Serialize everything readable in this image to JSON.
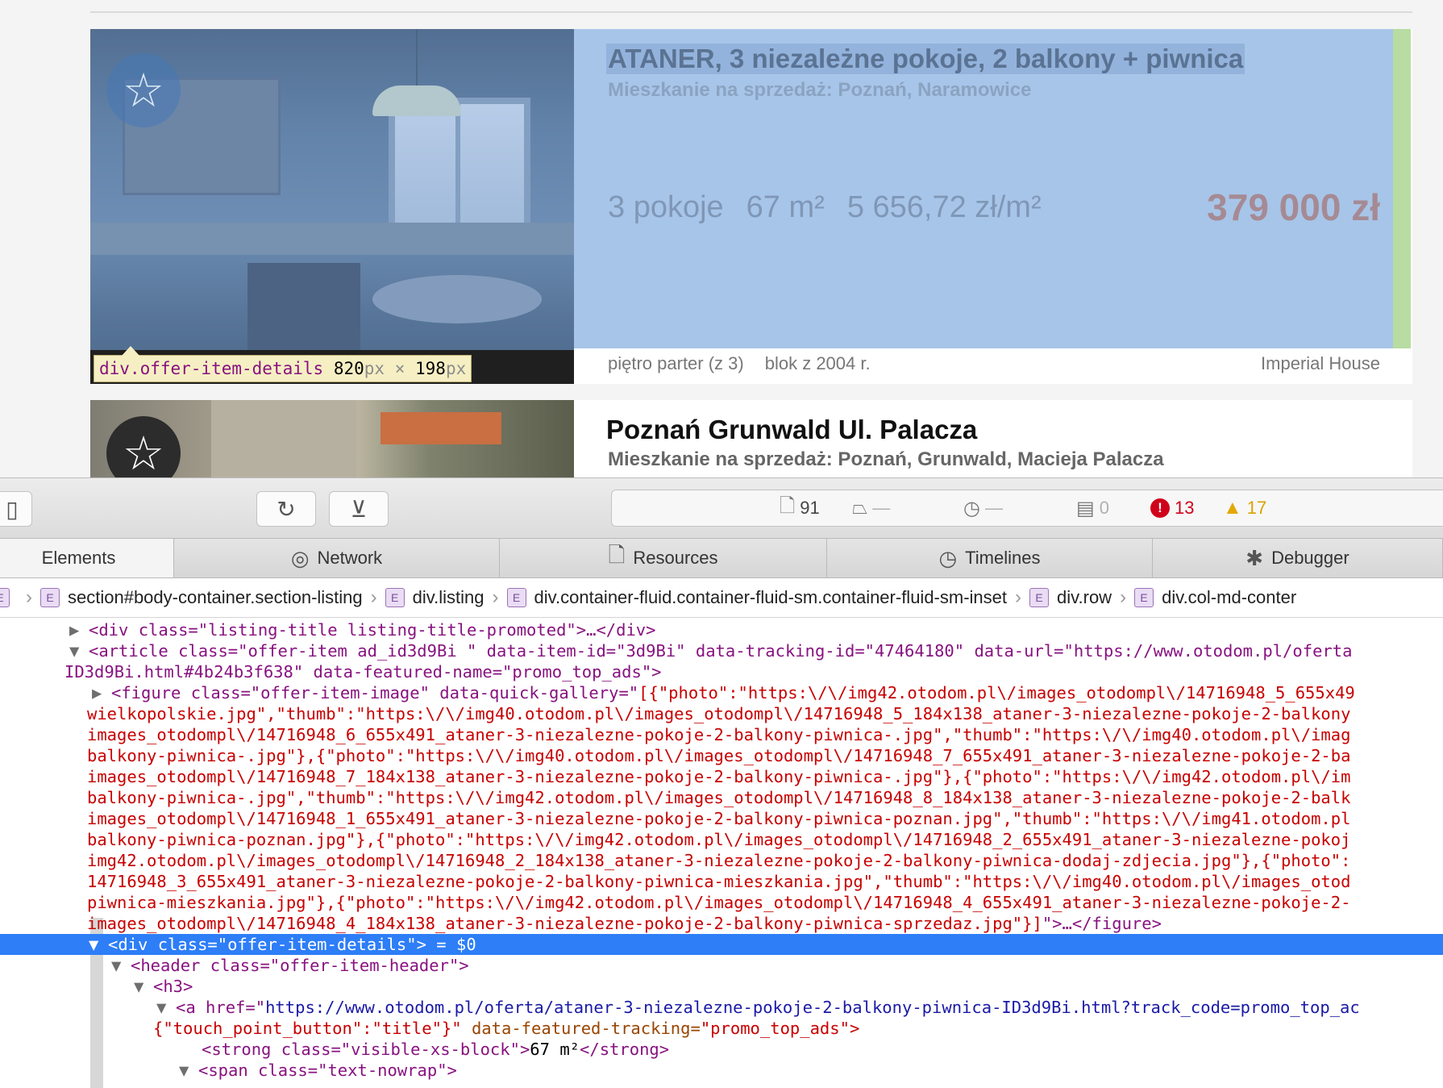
{
  "listing": {
    "offer1": {
      "title": "ATANER, 3 niezależne pokoje, 2 balkony + piwnica",
      "subtitle": "Mieszkanie na sprzedaż: Poznań, Naramowice",
      "rooms": "3 pokoje",
      "area": "67 m²",
      "price_per_m2": "5 656,72 zł/m²",
      "price": "379 000 zł",
      "floor": "piętro parter (z 3)",
      "building": "blok z 2004 r.",
      "agency": "Imperial House",
      "tooltip_selector": "div.offer-item-details",
      "tooltip_w": "820",
      "tooltip_h": "198",
      "tooltip_unit": "px",
      "tooltip_x": "×"
    },
    "offer2": {
      "title": "Poznań Grunwald Ul. Palacza",
      "subtitle": "Mieszkanie na sprzedaż: Poznań, Grunwald, Macieja Palacza"
    },
    "favorite_icon": "star-icon"
  },
  "devtools": {
    "dashboard": {
      "resources_count": "91",
      "load_size": "—",
      "load_time": "—",
      "logs_count": "0",
      "errors_count": "13",
      "warnings_count": "17"
    },
    "tabs": [
      {
        "label": "Elements"
      },
      {
        "label": "Network"
      },
      {
        "label": "Resources"
      },
      {
        "label": "Timelines"
      },
      {
        "label": "Debugger"
      }
    ],
    "breadcrumbs": [
      "section#body-container.section-listing",
      "div.listing",
      "div.container-fluid.container-fluid-sm.container-fluid-sm-inset",
      "div.row",
      "div.col-md-conter"
    ],
    "dom": {
      "l1": "<div class=\"listing-title listing-title-promoted\">…</div>",
      "l2": "<article class=\"offer-item ad_id3d9Bi \" data-item-id=\"3d9Bi\" data-tracking-id=\"47464180\" data-url=\"https://www.otodom.pl/oferta",
      "l3": "ID3d9Bi.html#4b24b3f638\" data-featured-name=\"promo_top_ads\">",
      "l4a": "<figure class=\"offer-item-image\" data-quick-gallery=\"",
      "l4b": "[{\"photo\":\"https:\\/\\/img42.otodom.pl\\/images_otodompl\\/14716948_5_655x49",
      "g1": "wielkopolskie.jpg\",\"thumb\":\"https:\\/\\/img40.otodom.pl\\/images_otodompl\\/14716948_5_184x138_ataner-3-niezalezne-pokoje-2-balkony",
      "g2": "images_otodompl\\/14716948_6_655x491_ataner-3-niezalezne-pokoje-2-balkony-piwnica-.jpg\",\"thumb\":\"https:\\/\\/img40.otodom.pl\\/imag",
      "g3": "balkony-piwnica-.jpg\"},{\"photo\":\"https:\\/\\/img40.otodom.pl\\/images_otodompl\\/14716948_7_655x491_ataner-3-niezalezne-pokoje-2-ba",
      "g4": "images_otodompl\\/14716948_7_184x138_ataner-3-niezalezne-pokoje-2-balkony-piwnica-.jpg\"},{\"photo\":\"https:\\/\\/img42.otodom.pl\\/im",
      "g5": "balkony-piwnica-.jpg\",\"thumb\":\"https:\\/\\/img42.otodom.pl\\/images_otodompl\\/14716948_8_184x138_ataner-3-niezalezne-pokoje-2-balk",
      "g6": "images_otodompl\\/14716948_1_655x491_ataner-3-niezalezne-pokoje-2-balkony-piwnica-poznan.jpg\",\"thumb\":\"https:\\/\\/img41.otodom.pl",
      "g7": "balkony-piwnica-poznan.jpg\"},{\"photo\":\"https:\\/\\/img42.otodom.pl\\/images_otodompl\\/14716948_2_655x491_ataner-3-niezalezne-pokoj",
      "g8": "img42.otodom.pl\\/images_otodompl\\/14716948_2_184x138_ataner-3-niezalezne-pokoje-2-balkony-piwnica-dodaj-zdjecia.jpg\"},{\"photo\":",
      "g9": "14716948_3_655x491_ataner-3-niezalezne-pokoje-2-balkony-piwnica-mieszkania.jpg\",\"thumb\":\"https:\\/\\/img40.otodom.pl\\/images_otod",
      "g10": "piwnica-mieszkania.jpg\"},{\"photo\":\"https:\\/\\/img42.otodom.pl\\/images_otodompl\\/14716948_4_655x491_ataner-3-niezalezne-pokoje-2-",
      "g11a": "images_otodompl\\/14716948_4_184x138_ataner-3-niezalezne-pokoje-2-balkony-piwnica-sprzedaz.jpg\"}]",
      "g11b": "\">…</figure>",
      "sel_a": "<div class=\"offer-item-details\">",
      "sel_b": " = $0",
      "h1": "<header class=\"offer-item-header\">",
      "h2": "<h3>",
      "a1a": "<a href=\"",
      "a1b": "https://www.otodom.pl/oferta/ataner-3-niezalezne-pokoje-2-balkony-piwnica-ID3d9Bi.html?track_code=promo_top_ac",
      "a2a": "{\"touch_point_button\":\"title\"}\"",
      "a2b": " data-featured-tracking=",
      "a2c": "\"promo_top_ads\">",
      "s1a": "<strong class=\"visible-xs-block\">",
      "s1b": "67 m²",
      "s1c": "</strong>",
      "s2": "<span class=\"text-nowrap\">"
    }
  }
}
